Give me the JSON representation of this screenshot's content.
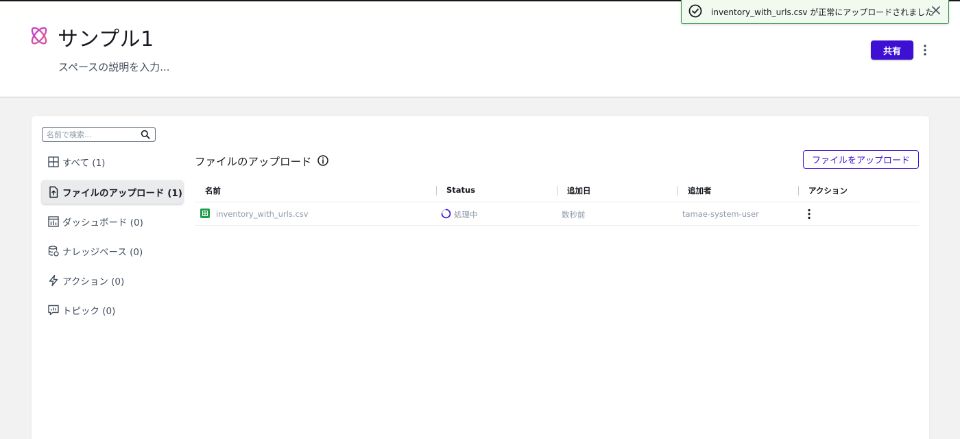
{
  "header": {
    "title": "サンプル1",
    "description": "スペースの説明を入力...",
    "share_label": "共有"
  },
  "toast": {
    "message": "inventory_with_urls.csv が正常にアップロードされました"
  },
  "search": {
    "placeholder": "名前で検索..."
  },
  "sidebar": {
    "items": [
      {
        "label": "すべて (1)",
        "icon": "grid-icon"
      },
      {
        "label": "ファイルのアップロード (1)",
        "icon": "file-upload-icon",
        "active": true
      },
      {
        "label": "ダッシュボード (0)",
        "icon": "dashboard-icon"
      },
      {
        "label": "ナレッジベース (0)",
        "icon": "database-icon"
      },
      {
        "label": "アクション (0)",
        "icon": "lightning-icon"
      },
      {
        "label": "トピック (0)",
        "icon": "topic-icon"
      }
    ]
  },
  "main": {
    "section_title": "ファイルのアップロード",
    "upload_label": "ファイルをアップロード",
    "table": {
      "columns": [
        "名前",
        "Status",
        "追加日",
        "追加者",
        "アクション"
      ],
      "rows": [
        {
          "name": "inventory_with_urls.csv",
          "status": "処理中",
          "added": "数秒前",
          "added_by": "tamae-system-user"
        }
      ]
    }
  },
  "colors": {
    "primary": "#3d10d4",
    "success": "#2b8a3e",
    "file_green": "#1e9e4a"
  }
}
